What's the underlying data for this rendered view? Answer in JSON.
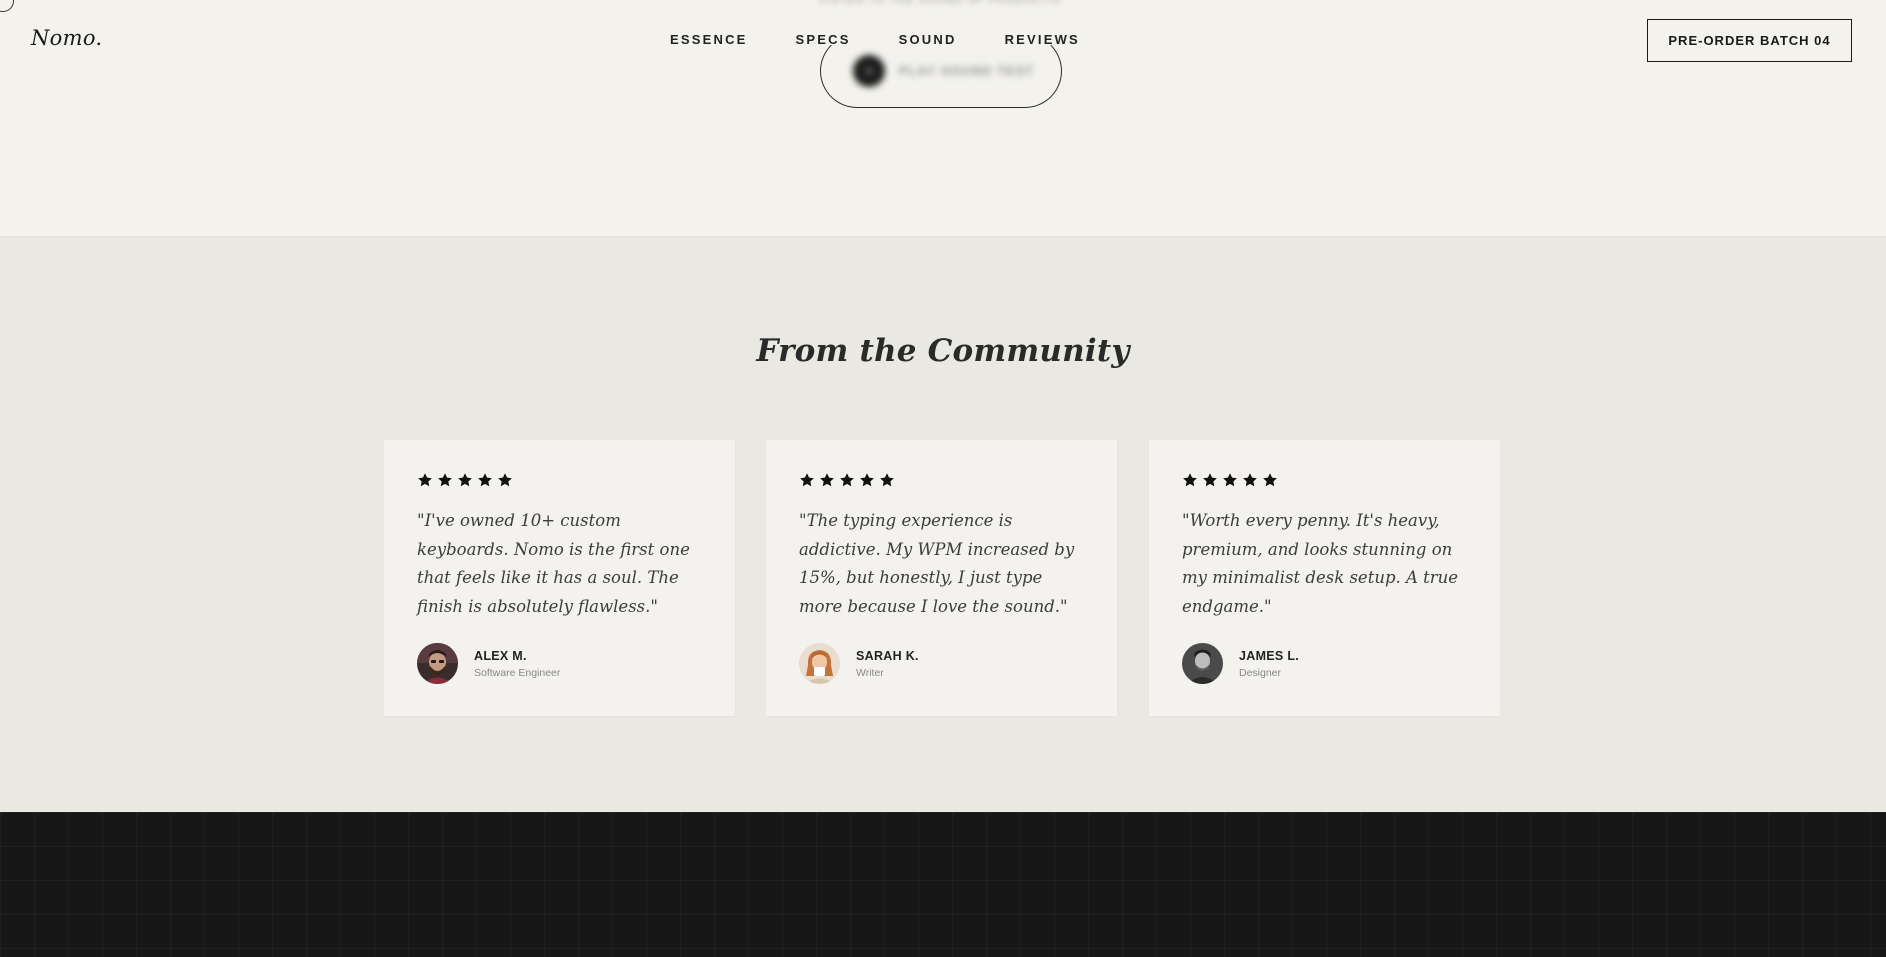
{
  "nav": {
    "logo": "Nomo.",
    "links": [
      "ESSENCE",
      "SPECS",
      "SOUND",
      "REVIEWS"
    ],
    "cta": "PRE-ORDER BATCH 04"
  },
  "hero": {
    "caption": "LISTEN TO THE SOUND OF PRODUCTIVITY",
    "play_label": "PLAY SOUND TEST"
  },
  "community": {
    "title": "From the Community",
    "reviews": [
      {
        "rating": 5,
        "quote": "\"I've owned 10+ custom keyboards. Nomo is the first one that feels like it has a soul. The finish is absolutely flawless.\"",
        "name": "ALEX M.",
        "role": "Software Engineer"
      },
      {
        "rating": 5,
        "quote": "\"The typing experience is addictive. My WPM increased by 15%, but honestly, I just type more because I love the sound.\"",
        "name": "SARAH K.",
        "role": "Writer"
      },
      {
        "rating": 5,
        "quote": "\"Worth every penny. It's heavy, premium, and looks stunning on my minimalist desk setup. A true endgame.\"",
        "name": "JAMES L.",
        "role": "Designer"
      }
    ]
  },
  "colors": {
    "ink": "#1a1a1a",
    "hero_bg": "#f3f2ed",
    "section_bg": "#e9e8e3",
    "card_bg": "#f3f2ee",
    "footer_bg": "#171717"
  }
}
